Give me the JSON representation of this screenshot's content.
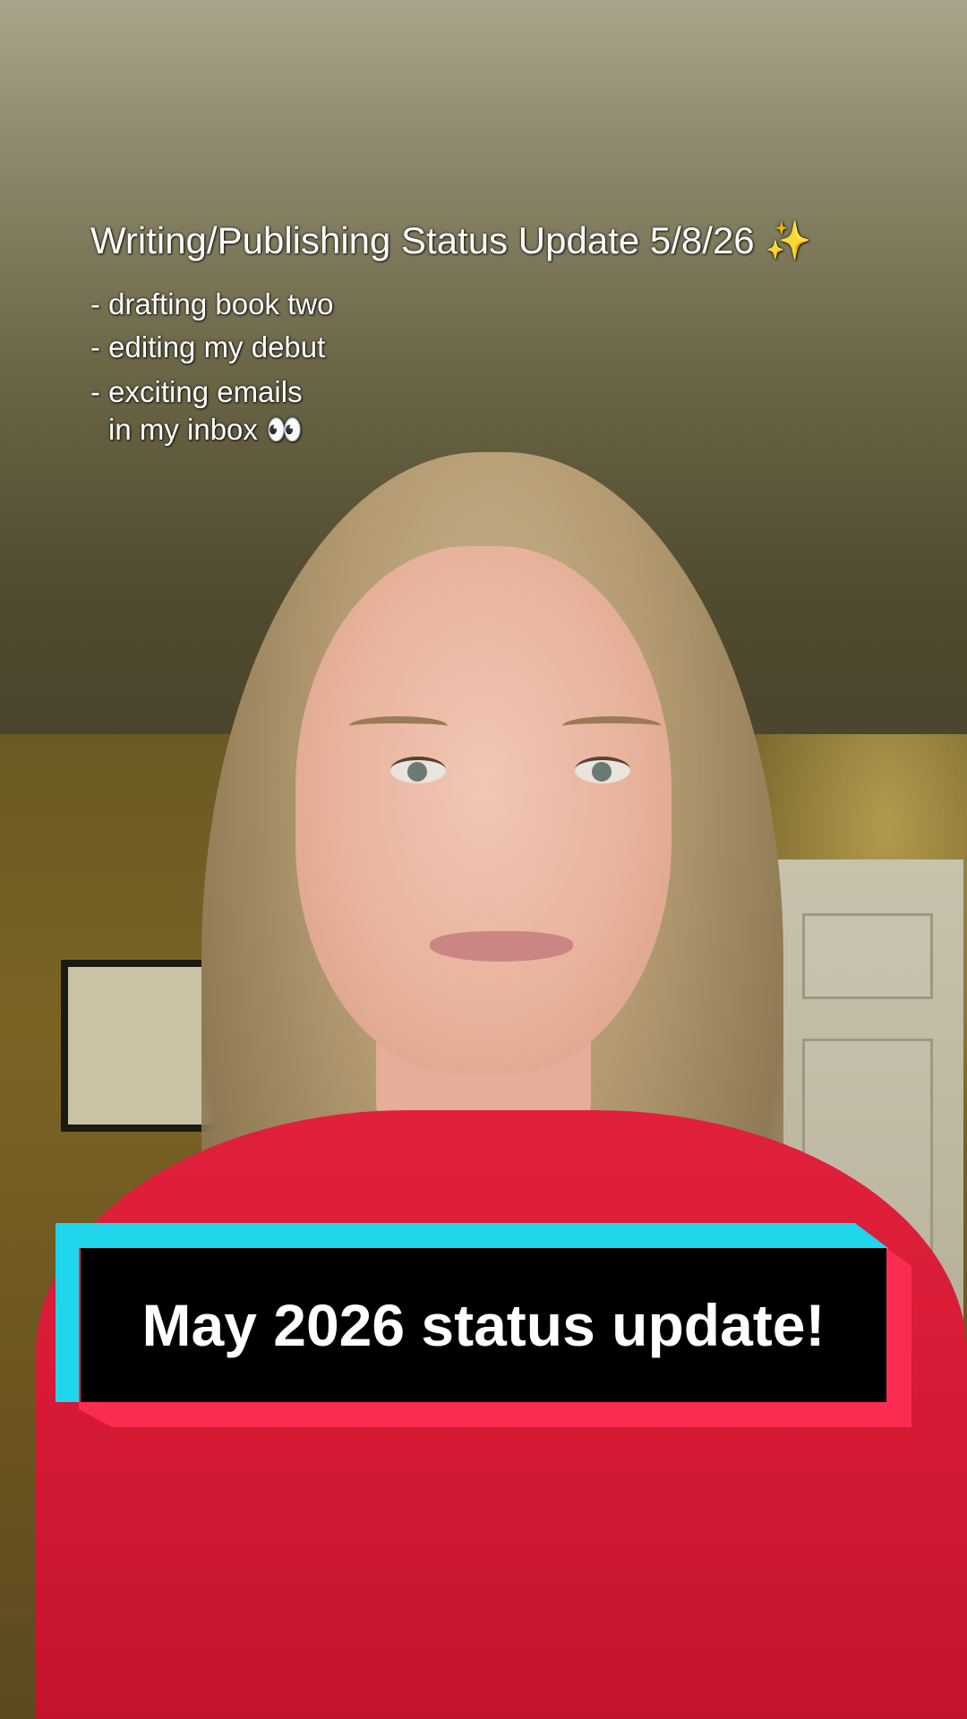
{
  "overlay": {
    "title": "Writing/Publishing Status Update 5/8/26 ✨",
    "bullets": [
      "- drafting book two",
      "- editing my debut",
      "- exciting emails",
      "in my inbox 👀"
    ]
  },
  "caption": {
    "text": "May 2026 status update!"
  },
  "colors": {
    "caption_bg": "#000000",
    "caption_accent_left": "#1fd6ec",
    "caption_accent_right": "#fb2c52",
    "shirt": "#d61a35"
  }
}
